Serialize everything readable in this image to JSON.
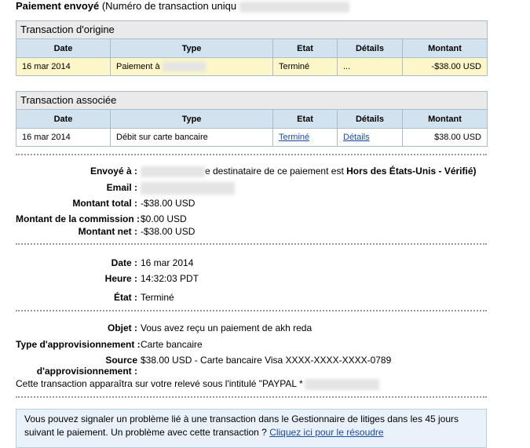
{
  "header": {
    "title_bold": "Paiement envoyé",
    "title_rest": "(Numéro de transaction uniqu"
  },
  "origin": {
    "heading": "Transaction d'origine",
    "columns": [
      "Date",
      "Type",
      "Etat",
      "Détails",
      "Montant"
    ],
    "row": {
      "date": "16 mar 2014",
      "type": "Paiement à",
      "status": "Terminé",
      "details": "...",
      "amount": "-$38.00 USD"
    }
  },
  "related": {
    "heading": "Transaction associée",
    "columns": [
      "Date",
      "Type",
      "Etat",
      "Détails",
      "Montant"
    ],
    "row": {
      "date": "16 mar 2014",
      "type": "Débit sur carte bancaire",
      "status": "Terminé",
      "details": "Détails",
      "amount": "$38.00 USD"
    }
  },
  "info": {
    "sent_to_label": "Envoyé à :",
    "sent_to_text": "e destinataire de ce paiement est",
    "sent_to_status": "Hors des États-Unis - Vérifié)",
    "email_label": "Email :",
    "total_label": "Montant total :",
    "total_value": "-$38.00 USD",
    "fee_label": "Montant de la commission :",
    "fee_value": "$0.00 USD",
    "net_label": "Montant net :",
    "net_value": "-$38.00 USD",
    "date_label": "Date :",
    "date_value": "16 mar 2014",
    "time_label": "Heure :",
    "time_value": "14:32:03 PDT",
    "state_label": "État :",
    "state_value": "Terminé",
    "subject_label": "Objet :",
    "subject_value": "Vous avez reçu un paiement de akh reda",
    "funding_type_label": "Type d'approvisionnement :",
    "funding_type_value": "Carte bancaire",
    "source_label_1": "Source",
    "source_label_2": "d'approvisionnement :",
    "source_value": "$38.00 USD - Carte bancaire Visa XXXX-XXXX-XXXX-0789",
    "statement_text": "Cette transaction apparaîtra sur votre relevé sous l'intitulé \"PAYPAL *"
  },
  "notice": {
    "text": "Vous pouvez signaler un problème lié à une transaction dans le Gestionnaire de litiges dans les 45 jours suivant le paiement. Un problème avec cette transaction ?",
    "link": "Cliquez ici pour le résoudre"
  }
}
